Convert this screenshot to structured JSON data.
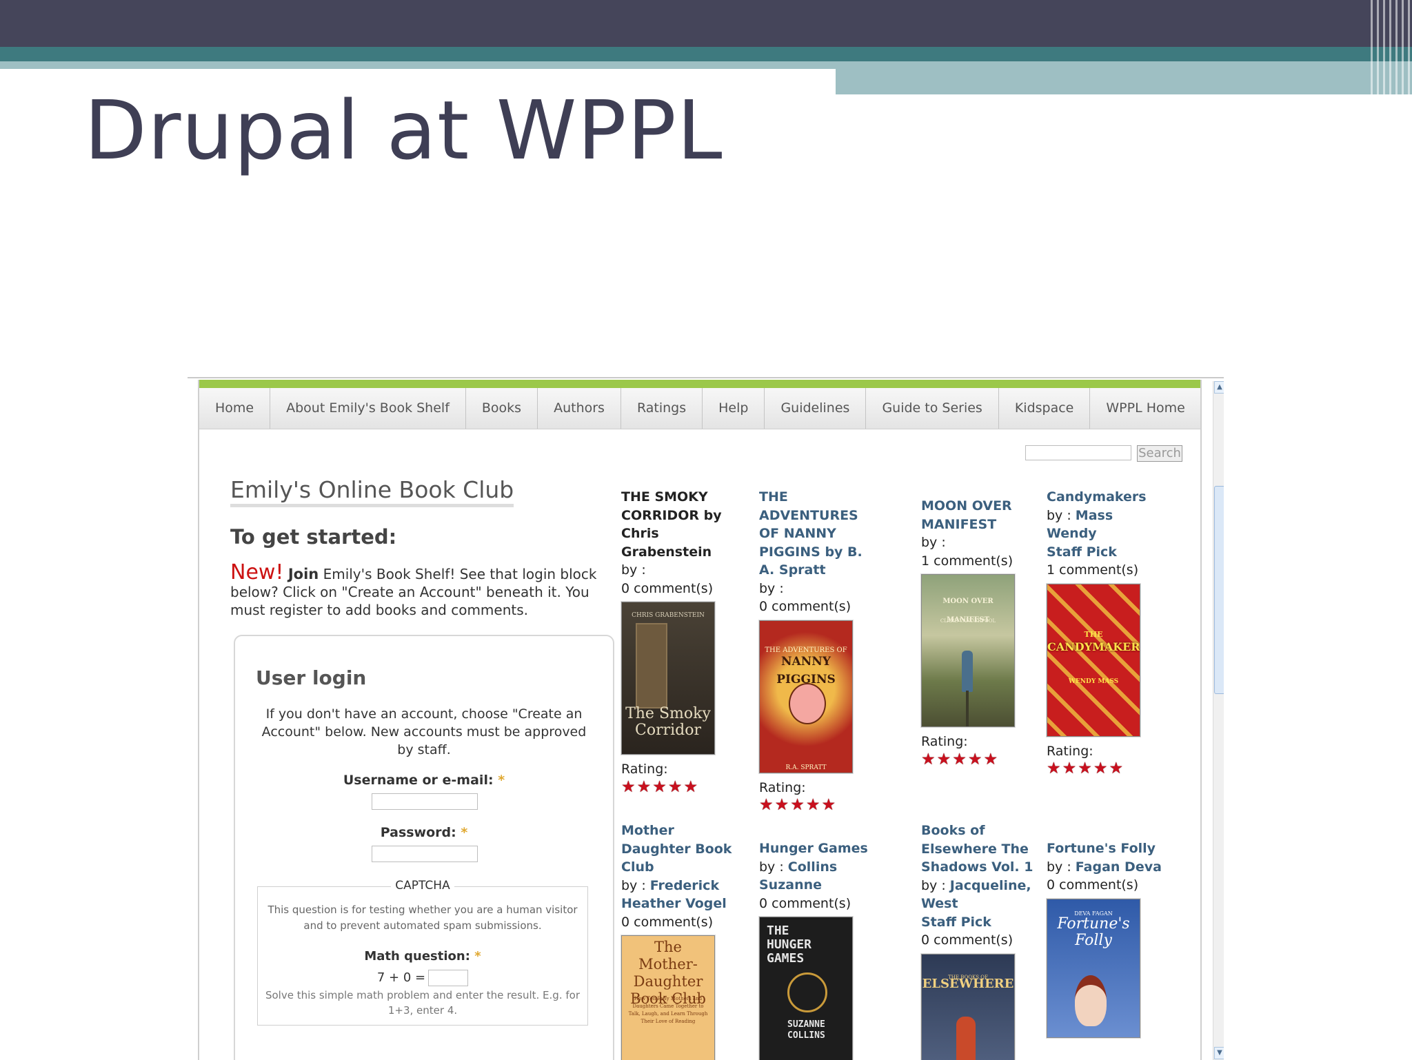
{
  "slide": {
    "title": "Drupal at WPPL"
  },
  "nav": [
    "Home",
    "About Emily's Book Shelf",
    "Books",
    "Authors",
    "Ratings",
    "Help",
    "Guidelines",
    "Guide to Series",
    "Kidspace",
    "WPPL Home"
  ],
  "search": {
    "button": "Search"
  },
  "page": {
    "title": "Emily's Online Book Club",
    "started": "To get started:",
    "intro_new": "New!",
    "intro_join": "Join",
    "intro_text": " Emily's Book Shelf! See that login block below? Click on \"Create an Account\" beneath it. You must register to add books and comments."
  },
  "login": {
    "heading": "User login",
    "desc": "If you don't have an account, choose \"Create an Account\" below. New accounts must be approved by staff.",
    "username_label": "Username or e-mail:",
    "password_label": "Password:",
    "required_mark": "*",
    "captcha": {
      "legend": "CAPTCHA",
      "desc": "This question is for testing whether you are a human visitor and to prevent automated spam submissions.",
      "math_label": "Math question:",
      "math_expr": "7 + 0 =",
      "hint": "Solve this simple math problem and enter the result. E.g. for 1+3, enter 4."
    }
  },
  "books": [
    {
      "title": "THE SMOKY CORRIDOR by Chris Grabenstein",
      "by": "by :",
      "author": "",
      "pick": "",
      "comments": "0 comment(s)",
      "rating_label": "Rating:",
      "stars": "★★★★★",
      "rating": 5,
      "cover_top": "CHRIS GRABENSTEIN",
      "cover_main": "The Smoky Corridor",
      "cover_bg": "#3a342c",
      "cover_fg": "#d8cfb8"
    },
    {
      "title": "THE ADVENTURES OF NANNY PIGGINS by B. A. Spratt",
      "by": "by :",
      "author": "",
      "pick": "",
      "comments": "0 comment(s)",
      "rating_label": "Rating:",
      "stars": "★★★★★",
      "rating": 5,
      "cover_top": "THE ADVENTURES OF",
      "cover_main": "NANNY PIGGINS",
      "cover_bottom": "R.A. SPRATT",
      "cover_bg": "#b4291f",
      "cover_fg": "#f5d27a"
    },
    {
      "title": "MOON OVER MANIFEST",
      "by": "by :",
      "author": "",
      "pick": "",
      "comments": "1 comment(s)",
      "rating_label": "Rating:",
      "stars": "★★★★★",
      "rating": 5,
      "cover_top": "MOON OVER MANIFEST",
      "cover_main": "CLARE VANDERPOOL",
      "cover_bg": "#7a8a55",
      "cover_fg": "#f2efd9"
    },
    {
      "title": "Candymakers",
      "by": "by :",
      "author": "Mass Wendy",
      "pick": "Staff Pick",
      "comments": "1 comment(s)",
      "rating_label": "Rating:",
      "stars": "★★★★★",
      "rating": 5,
      "cover_top": "THE",
      "cover_main": "CANDYMAKERS",
      "cover_bottom": "WENDY MASS",
      "cover_bg": "#c81e1e",
      "cover_fg": "#ffe14a"
    },
    {
      "title": "Mother Daughter Book Club",
      "by": "by :",
      "author": "Frederick Heather Vogel",
      "pick": "",
      "comments": "0 comment(s)",
      "cover_top": "The Mother-Daughter Book Club",
      "cover_main": "How Ten Busy Mothers and Daughters Came Together to Talk, Laugh, and Learn Through Their Love of Reading",
      "cover_bg": "#f1c27a",
      "cover_fg": "#7a3b12"
    },
    {
      "title": "Hunger Games",
      "by": "by :",
      "author": "Collins Suzanne",
      "pick": "",
      "comments": "0 comment(s)",
      "cover_top": "THE HUNGER GAMES",
      "cover_main": "SUZANNE COLLINS",
      "cover_bg": "#1d1d1d",
      "cover_fg": "#e6e6e6"
    },
    {
      "title": "Books of Elsewhere The Shadows Vol. 1",
      "by": "by :",
      "author": "Jacqueline, West",
      "pick": "Staff Pick",
      "comments": "0 comment(s)",
      "cover_top": "THE BOOKS OF",
      "cover_main": "ELSEWHERE",
      "cover_bg": "#3b4a66",
      "cover_fg": "#f0d080"
    },
    {
      "title": "Fortune's Folly",
      "by": "by :",
      "author": "Fagan Deva",
      "pick": "",
      "comments": "0 comment(s)",
      "cover_top": "DEVA FAGAN",
      "cover_main": "Fortune's Folly",
      "cover_bg": "#2f5aa8",
      "cover_fg": "#ffffff"
    }
  ]
}
